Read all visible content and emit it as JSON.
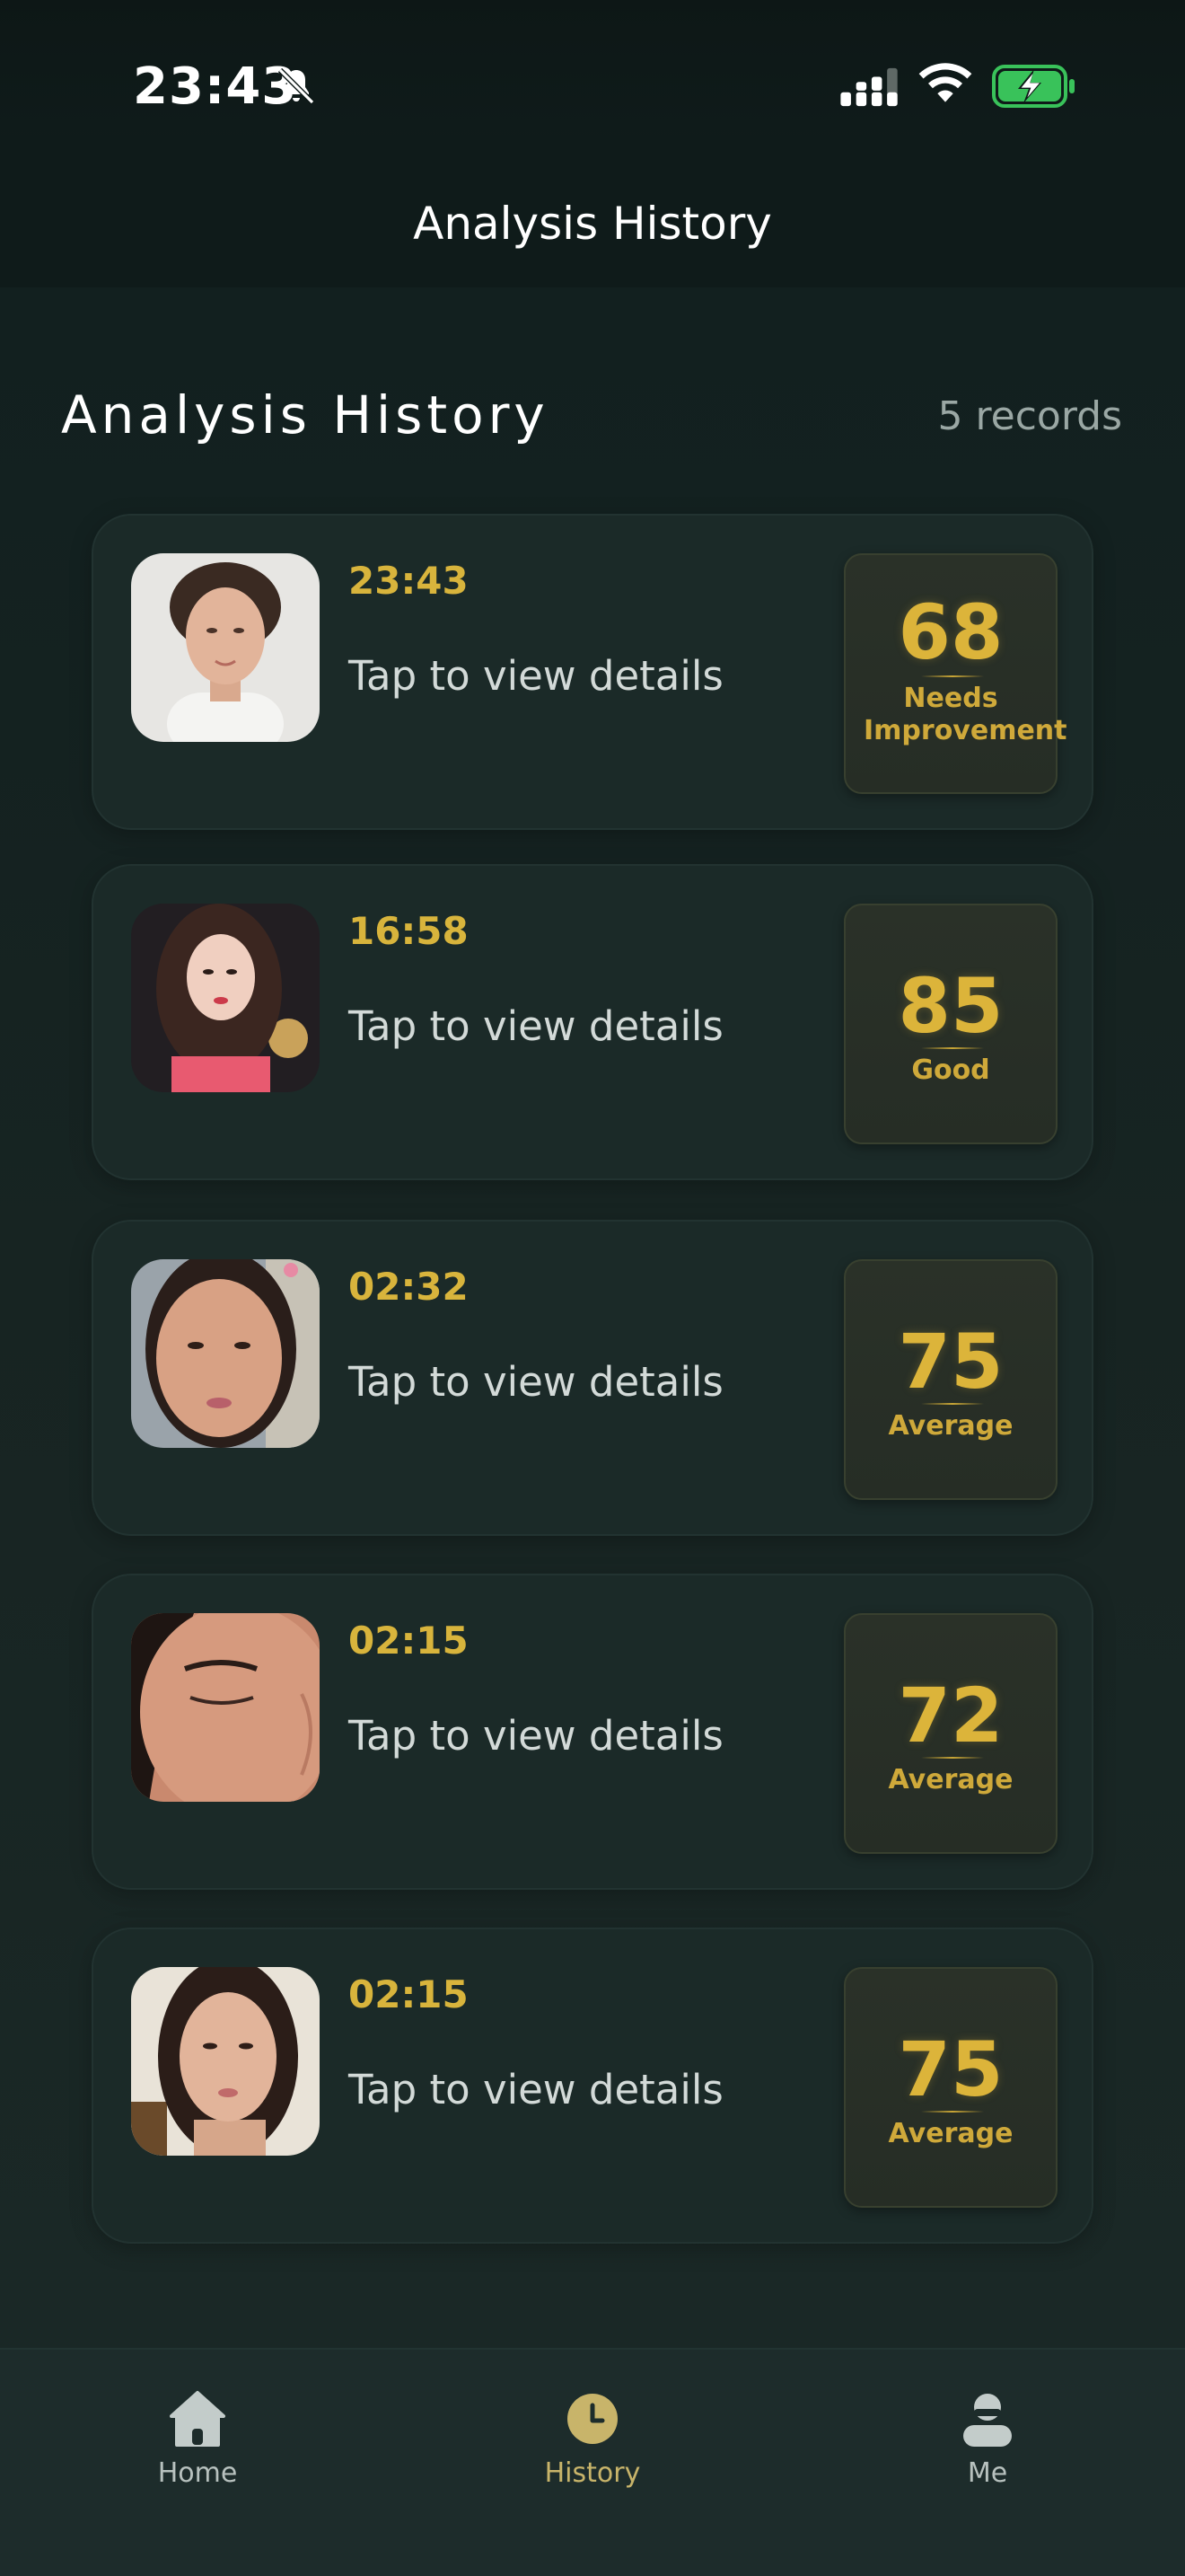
{
  "status_bar": {
    "time": "23:43"
  },
  "header": {
    "title": "Analysis History"
  },
  "section": {
    "title": "Analysis History",
    "count": "5 records"
  },
  "records": [
    {
      "time": "23:43",
      "subtitle": "Tap to view details",
      "score": "68",
      "rating": "Needs Improvement"
    },
    {
      "time": "16:58",
      "subtitle": "Tap to view details",
      "score": "85",
      "rating": "Good"
    },
    {
      "time": "02:32",
      "subtitle": "Tap to view details",
      "score": "75",
      "rating": "Average"
    },
    {
      "time": "02:15",
      "subtitle": "Tap to view details",
      "score": "72",
      "rating": "Average"
    },
    {
      "time": "02:15",
      "subtitle": "Tap to view details",
      "score": "75",
      "rating": "Average"
    }
  ],
  "tabs": [
    {
      "label": "Home",
      "icon": "home-icon"
    },
    {
      "label": "History",
      "icon": "history-clock-icon",
      "active": true
    },
    {
      "label": "Me",
      "icon": "profile-icon"
    }
  ],
  "colors": {
    "accent": "#dcb43a",
    "background": "#13201f",
    "card": "#1b2a28"
  }
}
